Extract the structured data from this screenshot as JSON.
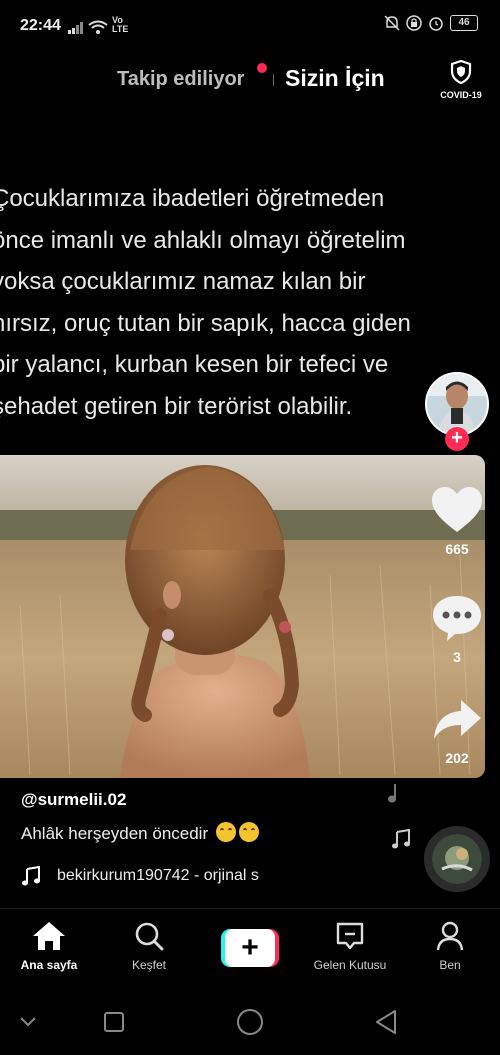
{
  "status_bar": {
    "time": "22:44",
    "network_label": "Vo LTE",
    "battery": "46"
  },
  "top_tabs": {
    "following": "Takip ediliyor",
    "for_you": "Sizin İçin",
    "covid_label": "COVID-19"
  },
  "quote": {
    "lines": [
      "Çocuklarımıza ibadetleri öğretmeden",
      "önce imanlı ve ahlaklı olmayı öğretelim",
      "yoksa çocuklarımız namaz kılan bir",
      "hırsız, oruç tutan bir sapık, hacca giden",
      "bir yalancı, kurban kesen bir tefeci ve",
      "şehadet getiren bir terörist olabilir."
    ]
  },
  "rail": {
    "likes": "665",
    "comments": "3",
    "shares": "202",
    "follow_symbol": "+"
  },
  "post": {
    "username": "@surmelii.02",
    "caption": "Ahlâk herşeyden öncedir",
    "music": "bekirkurum190742 - orjinal s"
  },
  "bottom_nav": {
    "home": "Ana sayfa",
    "discover": "Keşfet",
    "create": "+",
    "inbox": "Gelen Kutusu",
    "me": "Ben"
  },
  "colors": {
    "accent": "#fe2c55",
    "cyan": "#25f4ee",
    "background": "#000000"
  },
  "icons": [
    "silent-icon",
    "alarm-icon",
    "shield-icon",
    "heart-icon",
    "comment-icon",
    "share-icon",
    "music-note-icon",
    "home-icon",
    "search-icon",
    "inbox-icon",
    "profile-icon"
  ]
}
